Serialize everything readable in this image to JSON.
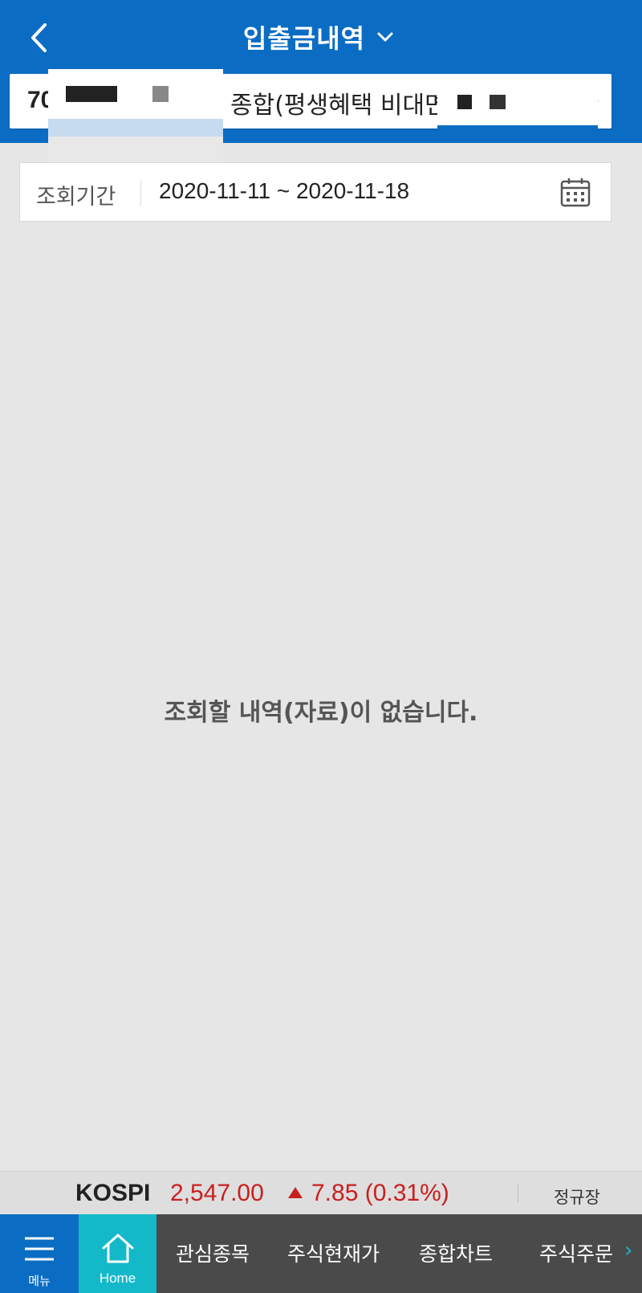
{
  "header": {
    "title": "입출금내역",
    "back_icon": "chevron-left-icon",
    "dropdown_icon": "chevron-down-icon"
  },
  "account": {
    "number_prefix": "70",
    "name": "종합(평생혜택 비대면)",
    "more_icon": "chevron-right-icon"
  },
  "period": {
    "label": "조회기간",
    "value": "2020-11-11 ~ 2020-11-18",
    "calendar_icon": "calendar-icon"
  },
  "empty_message": "조회할 내역(자료)이 없습니다.",
  "ticker": {
    "index_name": "KOSPI",
    "value": "2,547.00",
    "change": "7.85 (0.31%)",
    "direction_icon": "triangle-up-icon",
    "session": "정규장",
    "up_color": "#c8201f"
  },
  "bottom_nav": {
    "menu_label": "메뉴",
    "home_label": "Home",
    "items": [
      "관심종목",
      "주식현재가",
      "종합차트",
      "주식주문"
    ],
    "more_icon": "chevron-right-icon"
  },
  "colors": {
    "header_bg": "#0b6cc4",
    "home_bg": "#13b9c9",
    "nav_bg": "#4a4a4a"
  }
}
